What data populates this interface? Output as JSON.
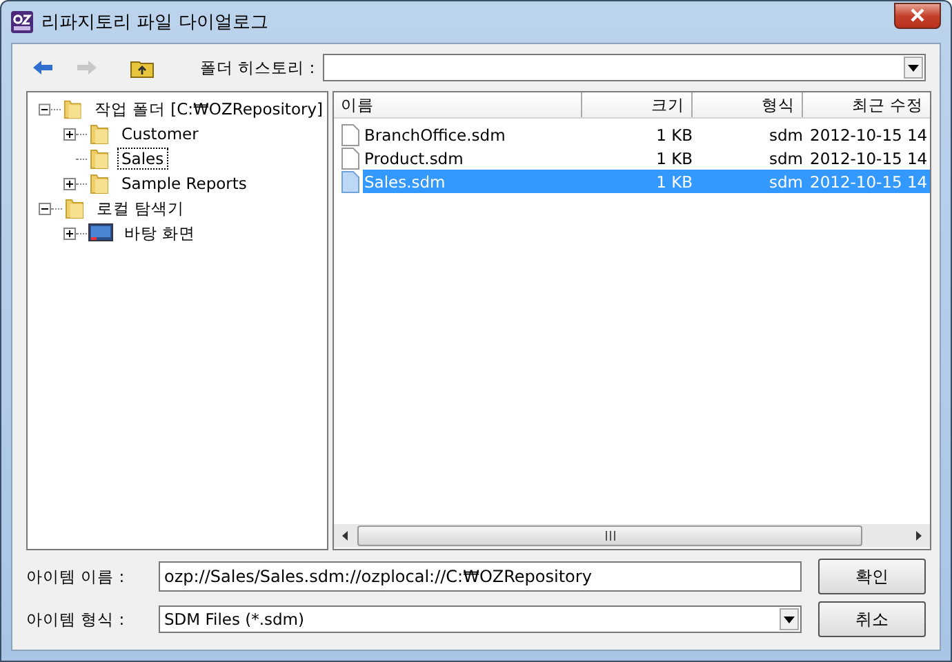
{
  "window": {
    "title": "리파지토리 파일 다이얼로그"
  },
  "toolbar": {
    "back_enabled": true,
    "forward_enabled": false,
    "history_label": "폴더 히스토리 :"
  },
  "tree": [
    {
      "label": "작업 폴더  [C:₩OZRepository]",
      "kind": "folder",
      "expanded": true,
      "selected": false,
      "children": [
        {
          "label": "Customer",
          "kind": "folder",
          "expanded": false,
          "selected": false
        },
        {
          "label": "Sales",
          "kind": "folder",
          "selected": true
        },
        {
          "label": "Sample Reports",
          "kind": "folder",
          "expanded": false,
          "selected": false
        }
      ]
    },
    {
      "label": "로컬 탐색기",
      "kind": "folder",
      "expanded": true,
      "selected": false,
      "children": [
        {
          "label": "바탕 화면",
          "kind": "desktop",
          "expanded": false,
          "selected": false
        }
      ]
    }
  ],
  "table": {
    "columns": [
      "이름",
      "크기",
      "형식",
      "최근 수정"
    ],
    "rows": [
      {
        "name": "BranchOffice.sdm",
        "size": "1 KB",
        "type": "sdm",
        "modified": "2012-10-15 14",
        "selected": false
      },
      {
        "name": "Product.sdm",
        "size": "1 KB",
        "type": "sdm",
        "modified": "2012-10-15 14",
        "selected": false
      },
      {
        "name": "Sales.sdm",
        "size": "1 KB",
        "type": "sdm",
        "modified": "2012-10-15 14",
        "selected": true
      }
    ]
  },
  "item_name": {
    "label": "아이템 이름 :",
    "value": "ozp://Sales/Sales.sdm://ozplocal://C:₩OZRepository"
  },
  "item_type": {
    "label": "아이템 형식 :",
    "value": "SDM Files (*.sdm)"
  },
  "buttons": [
    "확인",
    "취소"
  ]
}
